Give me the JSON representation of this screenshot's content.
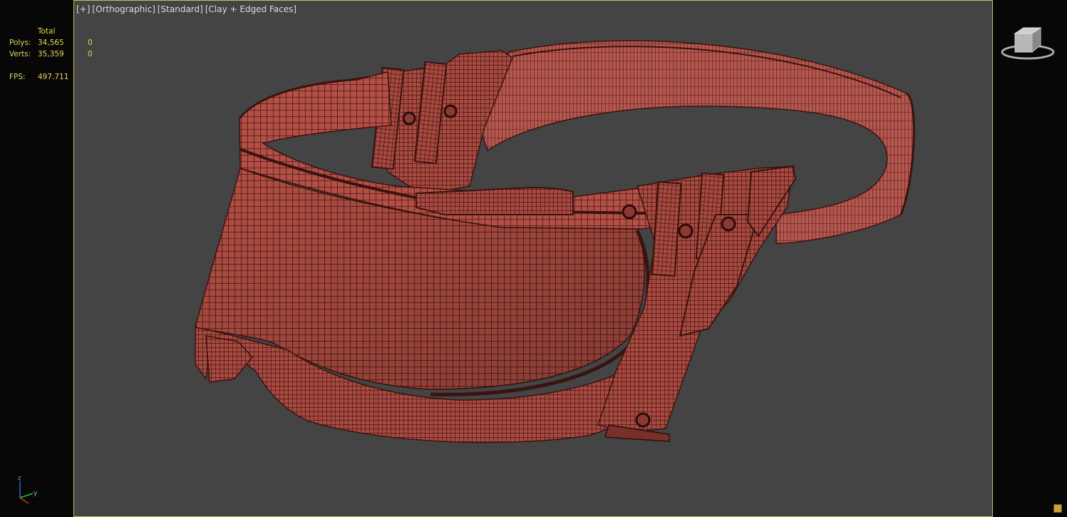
{
  "viewport": {
    "labels": [
      "[+]",
      "[Orthographic]",
      "[Standard]",
      "[Clay + Edged Faces]"
    ]
  },
  "stats": {
    "header": "Total",
    "rows": [
      {
        "label": "Polys:",
        "total": "34,565",
        "selected": "0"
      },
      {
        "label": "Verts:",
        "total": "35,359",
        "selected": "0"
      }
    ],
    "fps_label": "FPS:",
    "fps_value": "497.711"
  },
  "axis": {
    "z": "z",
    "y": "y"
  },
  "colors": {
    "clay": "#b34f44",
    "wire": "#3a1210",
    "background": "#444444",
    "border": "#c9c04a",
    "stats_text": "#e8d65a"
  }
}
